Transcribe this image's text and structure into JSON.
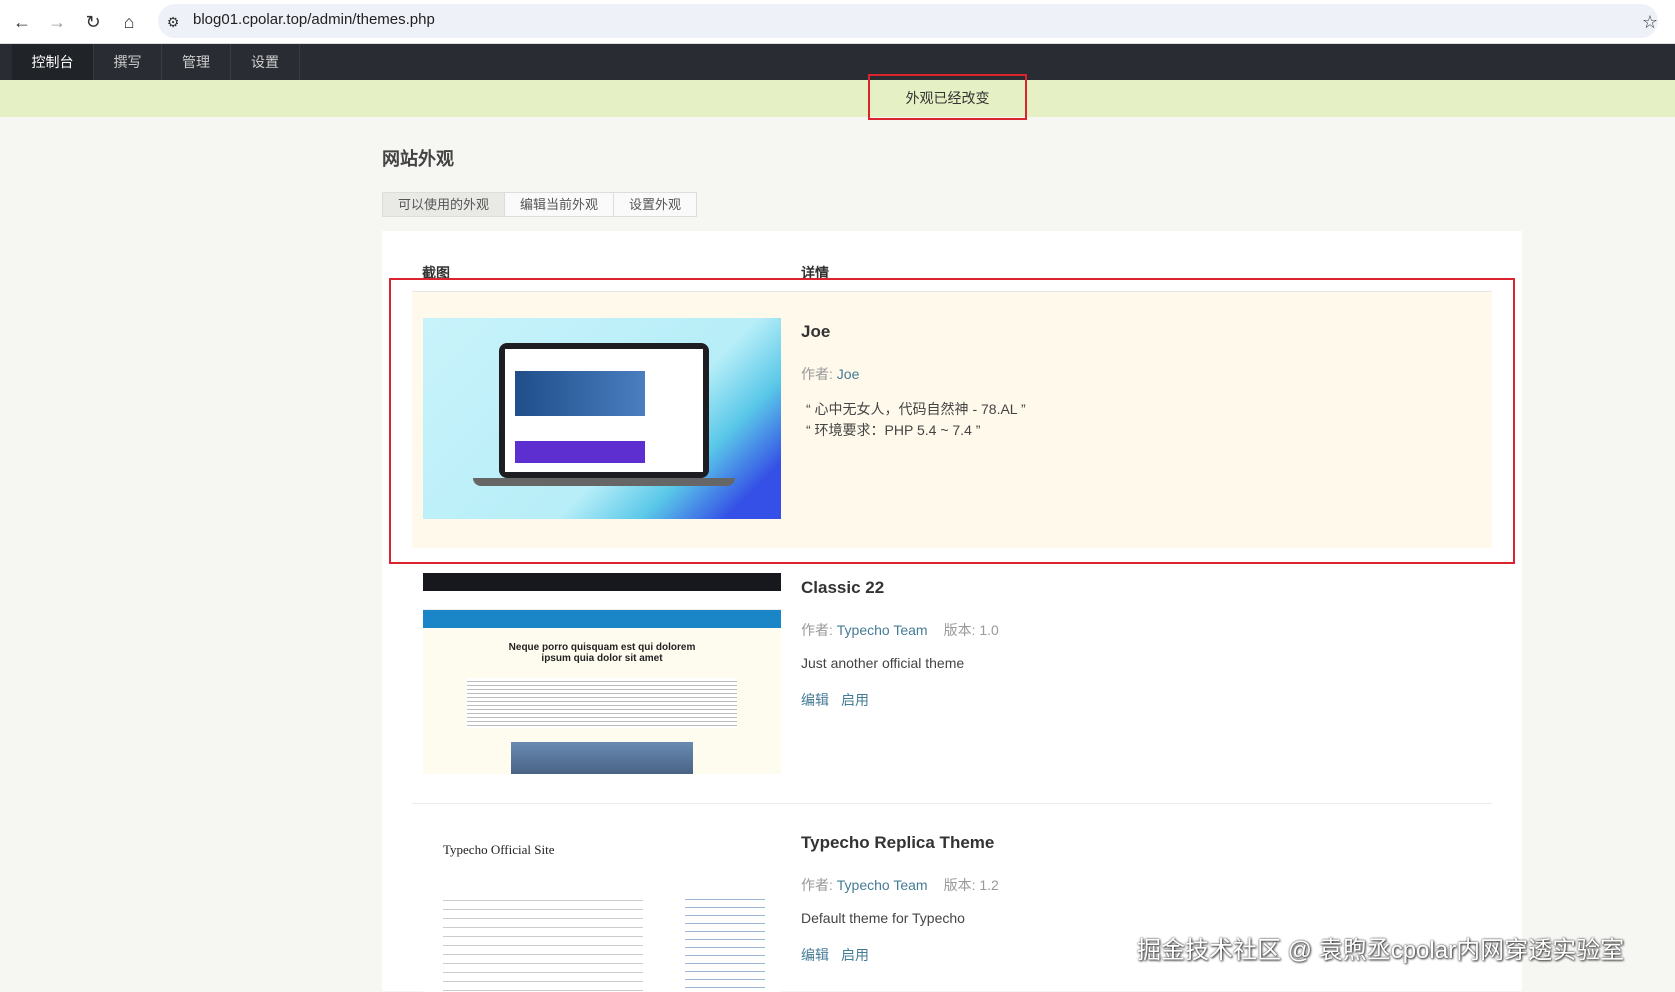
{
  "browser": {
    "url": "blog01.cpolar.top/admin/themes.php",
    "icons": [
      "back-icon",
      "forward-icon",
      "reload-icon",
      "home-icon",
      "site-settings-icon",
      "star-icon"
    ]
  },
  "nav": [
    "控制台",
    "撰写",
    "管理",
    "设置"
  ],
  "notice": "外观已经改变",
  "page_title": "网站外观",
  "tabs": [
    "可以使用的外观",
    "编辑当前外观",
    "设置外观"
  ],
  "columns": {
    "screenshot": "截图",
    "details": "详情"
  },
  "themes": [
    {
      "name": "Joe",
      "author_label": "作者: ",
      "author": "Joe",
      "version": "",
      "desc_lines": [
        "“ 心中无女人，代码自然神 - 78.AL ”",
        "“ 环境要求：PHP 5.4 ~ 7.4 ”"
      ],
      "actions": []
    },
    {
      "name": "Classic 22",
      "author_label": "作者: ",
      "author": "Typecho Team",
      "version": "版本: 1.0",
      "desc_lines": [
        "Just another official theme"
      ],
      "actions": [
        "编辑",
        "启用"
      ],
      "thumb_title": "Neque porro quisquam est qui dolorem ipsum quia dolor sit amet"
    },
    {
      "name": "Typecho Replica Theme",
      "author_label": "作者: ",
      "author": "Typecho Team",
      "version": "版本: 1.2",
      "desc_lines": [
        "Default theme for Typecho"
      ],
      "actions": [
        "编辑",
        "启用"
      ],
      "thumb_title": "Typecho Official Site"
    }
  ],
  "watermark": "掘金技术社区 @ 袁煦丞cpolar内网穿透实验室",
  "colors": {
    "nav": "#292d33",
    "notice": "#e6f0c5",
    "highlight": "#fef9ea",
    "link": "#467b96",
    "red": "#d9232d"
  }
}
